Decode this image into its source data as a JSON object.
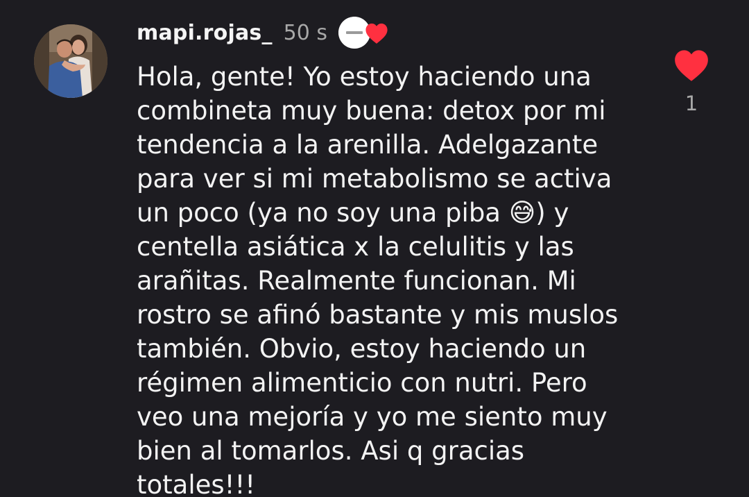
{
  "comment": {
    "username": "mapi.rojas_",
    "timestamp": "50 s",
    "liked_by_author_badge": {
      "icon": "heart-icon",
      "color": "#ff3040"
    },
    "text": "Hola, gente! Yo estoy haciendo una\ncombineta muy buena: detox por mi\ntendencia a la arenilla. Adelgazante\npara ver si mi metabolismo se activa\nun poco (ya no soy una piba 😅) y\ncentella asiática x la celulitis y las\narañitas. Realmente funcionan. Mi\nrostro se afinó bastante y mis muslos\ntambién. Obvio, estoy haciendo un\nrégimen alimenticio con nutri. Pero\nveo una mejoría y yo me siento muy\nbien al tomarlos. Asi q gracias\ntotales!!!",
    "like": {
      "icon": "heart-filled-icon",
      "color": "#ff3040",
      "count": "1"
    }
  },
  "theme": {
    "background": "#1d1c21",
    "text": "#f3f3f3",
    "secondary_text": "#a8a8a8"
  }
}
